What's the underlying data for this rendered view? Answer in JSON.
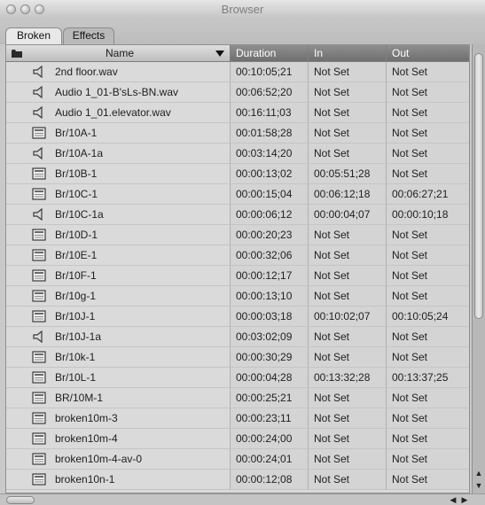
{
  "window": {
    "title": "Browser"
  },
  "tabs": [
    "Broken",
    "Effects"
  ],
  "columns": {
    "name": "Name",
    "duration": "Duration",
    "in": "In",
    "out": "Out"
  },
  "icons": {
    "folder": "folder-icon",
    "audio": "speaker-icon",
    "video": "film-clip-icon",
    "sort": "sort-descending-icon"
  },
  "rows": [
    {
      "icon": "audio",
      "name": "2nd floor.wav",
      "duration": "00:10:05;21",
      "in": "Not Set",
      "out": "Not Set"
    },
    {
      "icon": "audio",
      "name": "Audio 1_01-B'sLs-BN.wav",
      "duration": "00:06:52;20",
      "in": "Not Set",
      "out": "Not Set"
    },
    {
      "icon": "audio",
      "name": "Audio 1_01.elevator.wav",
      "duration": "00:16:11;03",
      "in": "Not Set",
      "out": "Not Set"
    },
    {
      "icon": "video",
      "name": "Br/10A-1",
      "duration": "00:01:58;28",
      "in": "Not Set",
      "out": "Not Set"
    },
    {
      "icon": "audio",
      "name": "Br/10A-1a",
      "duration": "00:03:14;20",
      "in": "Not Set",
      "out": "Not Set"
    },
    {
      "icon": "video",
      "name": "Br/10B-1",
      "duration": "00:00:13;02",
      "in": "00:05:51;28",
      "out": "Not Set"
    },
    {
      "icon": "video",
      "name": "Br/10C-1",
      "duration": "00:00:15;04",
      "in": "00:06:12;18",
      "out": "00:06:27;21"
    },
    {
      "icon": "audio",
      "name": "Br/10C-1a",
      "duration": "00:00:06;12",
      "in": "00:00:04;07",
      "out": "00:00:10;18"
    },
    {
      "icon": "video",
      "name": "Br/10D-1",
      "duration": "00:00:20;23",
      "in": "Not Set",
      "out": "Not Set"
    },
    {
      "icon": "video",
      "name": "Br/10E-1",
      "duration": "00:00:32;06",
      "in": "Not Set",
      "out": "Not Set"
    },
    {
      "icon": "video",
      "name": "Br/10F-1",
      "duration": "00:00:12;17",
      "in": "Not Set",
      "out": "Not Set"
    },
    {
      "icon": "video",
      "name": "Br/10g-1",
      "duration": "00:00:13;10",
      "in": "Not Set",
      "out": "Not Set"
    },
    {
      "icon": "video",
      "name": "Br/10J-1",
      "duration": "00:00:03;18",
      "in": "00:10:02;07",
      "out": "00:10:05;24"
    },
    {
      "icon": "audio",
      "name": "Br/10J-1a",
      "duration": "00:03:02;09",
      "in": "Not Set",
      "out": "Not Set"
    },
    {
      "icon": "video",
      "name": "Br/10k-1",
      "duration": "00:00:30;29",
      "in": "Not Set",
      "out": "Not Set"
    },
    {
      "icon": "video",
      "name": "Br/10L-1",
      "duration": "00:00:04;28",
      "in": "00:13:32;28",
      "out": "00:13:37;25"
    },
    {
      "icon": "video",
      "name": "BR/10M-1",
      "duration": "00:00:25;21",
      "in": "Not Set",
      "out": "Not Set"
    },
    {
      "icon": "video",
      "name": "broken10m-3",
      "duration": "00:00:23;11",
      "in": "Not Set",
      "out": "Not Set"
    },
    {
      "icon": "video",
      "name": "broken10m-4",
      "duration": "00:00:24;00",
      "in": "Not Set",
      "out": "Not Set"
    },
    {
      "icon": "video",
      "name": "broken10m-4-av-0",
      "duration": "00:00:24;01",
      "in": "Not Set",
      "out": "Not Set"
    },
    {
      "icon": "video",
      "name": "broken10n-1",
      "duration": "00:00:12;08",
      "in": "Not Set",
      "out": "Not Set"
    }
  ]
}
